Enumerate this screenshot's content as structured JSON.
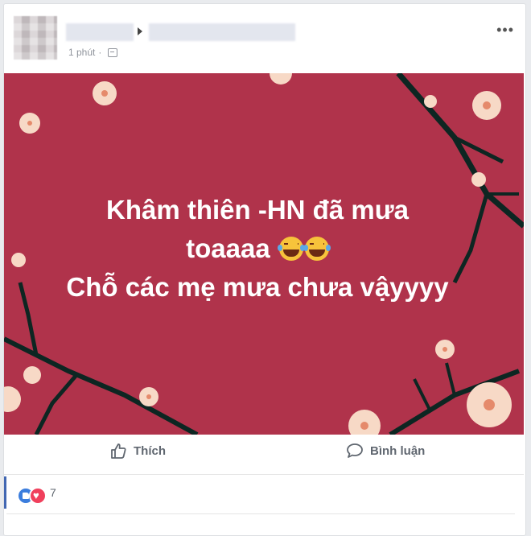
{
  "post": {
    "time": "1 phút",
    "more_label": "•••",
    "text_lines": [
      "Khâm thiên -HN đã mưa",
      "toaaaa",
      "Chỗ các mẹ mưa chưa vậyyyy"
    ],
    "emoji_icons": [
      "tears-of-joy-emoji",
      "tears-of-joy-emoji"
    ],
    "background_color": "#b0334b"
  },
  "actions": {
    "like_label": "Thích",
    "comment_label": "Bình luận"
  },
  "reactions": {
    "count": "7",
    "icons": [
      "like-reaction-icon",
      "love-reaction-icon"
    ]
  }
}
